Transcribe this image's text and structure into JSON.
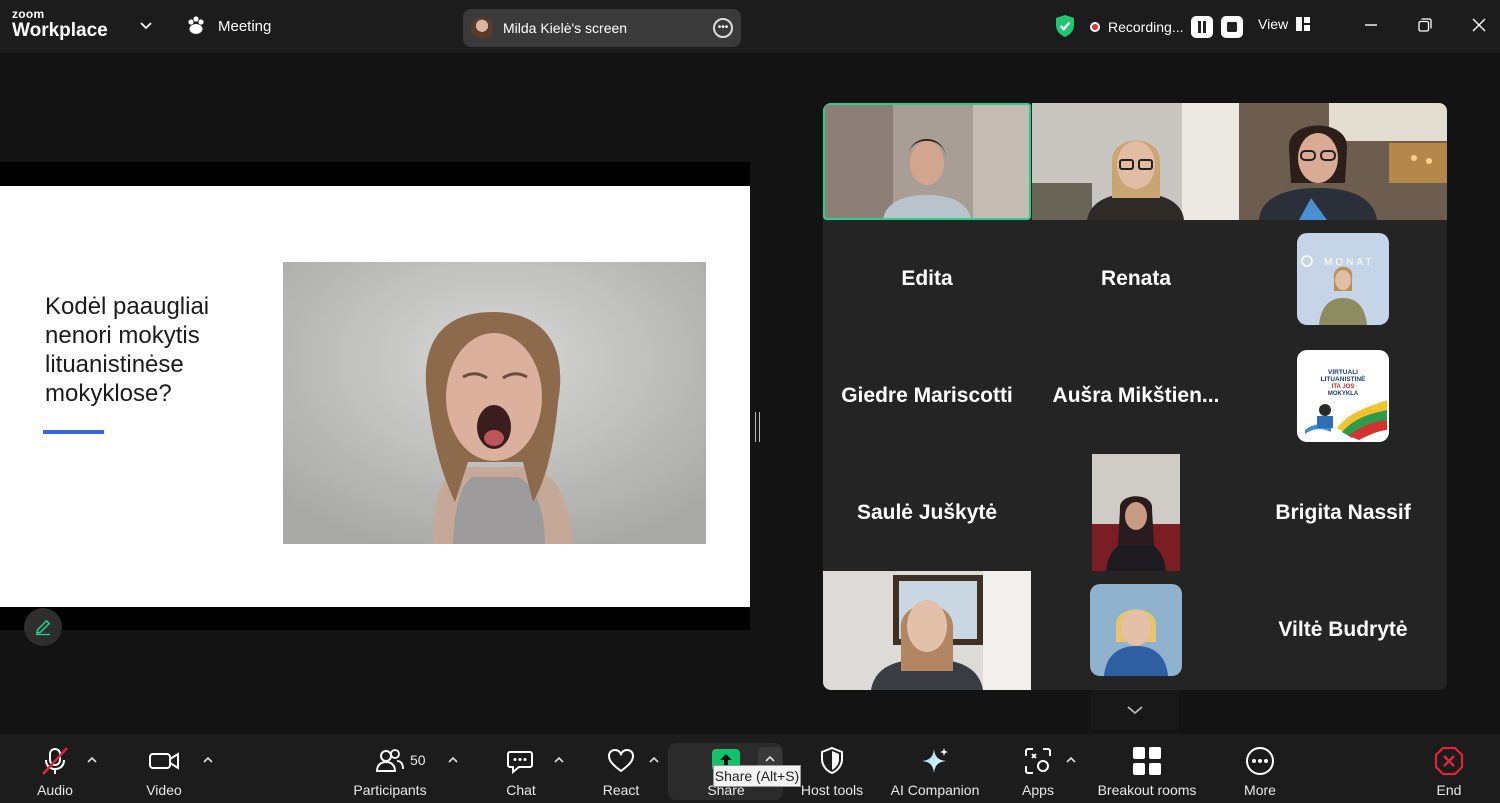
{
  "app": {
    "brand_top": "zoom",
    "brand_bottom": "Workplace",
    "meeting_label": "Meeting"
  },
  "share_pill": {
    "label": "Milda Kielė's screen"
  },
  "recording": {
    "label": "Recording..."
  },
  "view_label": "View",
  "slide": {
    "title": "Kodėl paaugliai\nnenori mokytis\nlituanistinėse\nmokyklose?",
    "accent_color": "#3a66db"
  },
  "gallery": {
    "names": {
      "edita": "Edita",
      "renata": "Renata",
      "giedre": "Giedre Mariscotti",
      "ausra": "Aušra  Mikštien...",
      "saule": "Saulė Juškytė",
      "brigita": "Brigita Nassif",
      "vilte": "Viltė Budrytė"
    },
    "logo_text": {
      "monat": "MONAT",
      "school_1": "VIRTUALI",
      "school_2": "LITUANISTINĖ",
      "school_3": "ITA   JOS",
      "school_4": "MOKYKLA"
    },
    "active_speaker_color": "#2ad18d"
  },
  "toolbar": {
    "audio": "Audio",
    "video": "Video",
    "participants": "Participants",
    "participants_count": "50",
    "chat": "Chat",
    "react": "React",
    "share": "Share",
    "share_tooltip": "Share (Alt+S)",
    "host_tools": "Host tools",
    "ai_companion": "AI Companion",
    "apps": "Apps",
    "breakout": "Breakout rooms",
    "more": "More",
    "end": "End",
    "share_color": "#12c26b",
    "end_color": "#e0243b"
  }
}
